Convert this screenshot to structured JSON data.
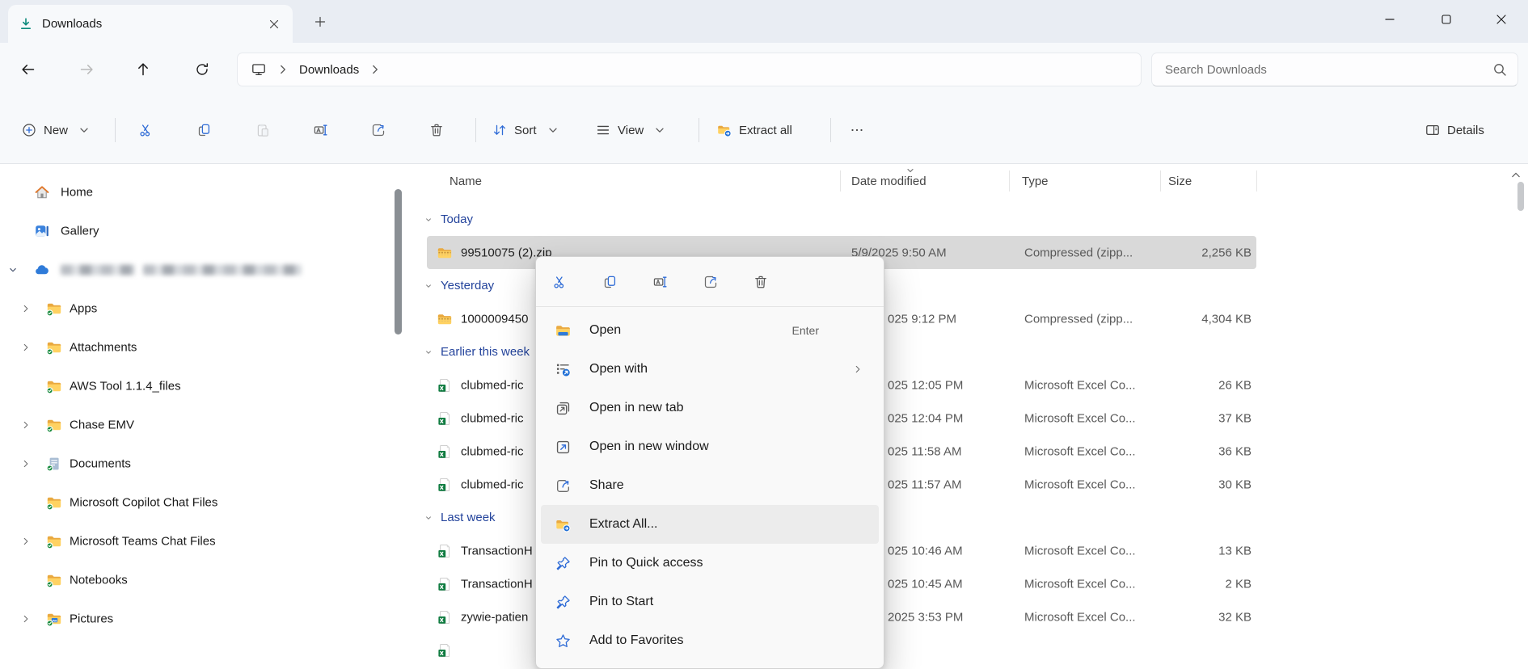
{
  "titlebar": {
    "tab_title": "Downloads"
  },
  "nav": {
    "breadcrumb": "Downloads"
  },
  "search": {
    "placeholder": "Search Downloads"
  },
  "toolbar": {
    "new": "New",
    "sort": "Sort",
    "view": "View",
    "extract_all": "Extract all",
    "details": "Details"
  },
  "colors": {
    "accent": "#2e6bd6",
    "group_header_text": "#24449c",
    "selected_row_bg": "#d9d9d9",
    "folder_yellow": "#ffd262",
    "excel_green": "#107c41",
    "onedrive_blue": "#2f7bd9"
  },
  "sidebar": {
    "items": [
      {
        "label": "Home",
        "icon": "home",
        "level": 0,
        "chevron": ""
      },
      {
        "label": "Gallery",
        "icon": "gallery",
        "level": 0,
        "chevron": ""
      },
      {
        "label": "",
        "icon": "cloud",
        "level": 0,
        "chevron": "down",
        "redacted": true
      },
      {
        "label": "Apps",
        "icon": "folder",
        "level": 1,
        "chevron": "right"
      },
      {
        "label": "Attachments",
        "icon": "folder",
        "level": 1,
        "chevron": "right"
      },
      {
        "label": "AWS Tool 1.1.4_files",
        "icon": "folder",
        "level": 1,
        "chevron": ""
      },
      {
        "label": "Chase EMV",
        "icon": "folder",
        "level": 1,
        "chevron": "right"
      },
      {
        "label": "Documents",
        "icon": "documents",
        "level": 1,
        "chevron": "right"
      },
      {
        "label": "Microsoft Copilot Chat Files",
        "icon": "folder",
        "level": 1,
        "chevron": ""
      },
      {
        "label": "Microsoft Teams Chat Files",
        "icon": "folder",
        "level": 1,
        "chevron": "right"
      },
      {
        "label": "Notebooks",
        "icon": "folder",
        "level": 1,
        "chevron": ""
      },
      {
        "label": "Pictures",
        "icon": "pictures",
        "level": 1,
        "chevron": "right"
      }
    ]
  },
  "list": {
    "columns": [
      "Name",
      "Date modified",
      "Type",
      "Size"
    ],
    "groups": [
      {
        "label": "Today",
        "rows": [
          {
            "name": "99510075 (2).zip",
            "icon": "zip",
            "date": "5/9/2025 9:50 AM",
            "clipped": false,
            "type": "Compressed (zipp...",
            "size": "2,256 KB",
            "selected": true
          }
        ]
      },
      {
        "label": "Yesterday",
        "rows": [
          {
            "name": "1000009450",
            "icon": "zip",
            "date": "025 9:12 PM",
            "clipped": true,
            "type": "Compressed (zipp...",
            "size": "4,304 KB",
            "selected": false
          }
        ]
      },
      {
        "label": "Earlier this week",
        "rows": [
          {
            "name": "clubmed-ric",
            "icon": "excel",
            "date": "025 12:05 PM",
            "clipped": true,
            "type": "Microsoft Excel Co...",
            "size": "26 KB",
            "selected": false
          },
          {
            "name": "clubmed-ric",
            "icon": "excel",
            "date": "025 12:04 PM",
            "clipped": true,
            "type": "Microsoft Excel Co...",
            "size": "37 KB",
            "selected": false
          },
          {
            "name": "clubmed-ric",
            "icon": "excel",
            "date": "025 11:58 AM",
            "clipped": true,
            "type": "Microsoft Excel Co...",
            "size": "36 KB",
            "selected": false
          },
          {
            "name": "clubmed-ric",
            "icon": "excel",
            "date": "025 11:57 AM",
            "clipped": true,
            "type": "Microsoft Excel Co...",
            "size": "30 KB",
            "selected": false
          }
        ]
      },
      {
        "label": "Last week",
        "rows": [
          {
            "name": "TransactionH",
            "icon": "excel",
            "date": "025 10:46 AM",
            "clipped": true,
            "type": "Microsoft Excel Co...",
            "size": "13 KB",
            "selected": false
          },
          {
            "name": "TransactionH",
            "icon": "excel",
            "date": "025 10:45 AM",
            "clipped": true,
            "type": "Microsoft Excel Co...",
            "size": "2 KB",
            "selected": false
          },
          {
            "name": "zywie-patien",
            "icon": "excel",
            "date": "2025 3:53 PM",
            "clipped": true,
            "type": "Microsoft Excel Co...",
            "size": "32 KB",
            "selected": false
          }
        ]
      }
    ],
    "partial_row": {
      "icon": "excel"
    }
  },
  "menu": {
    "quick_icons": [
      "cut",
      "copy",
      "rename",
      "share",
      "delete"
    ],
    "items": [
      {
        "label": "Open",
        "icon": "open",
        "shortcut": "Enter",
        "submenu": false,
        "highlighted": false
      },
      {
        "label": "Open with",
        "icon": "openwith",
        "shortcut": "",
        "submenu": true,
        "highlighted": false
      },
      {
        "label": "Open in new tab",
        "icon": "newtab",
        "shortcut": "",
        "submenu": false,
        "highlighted": false
      },
      {
        "label": "Open in new window",
        "icon": "newwindow",
        "shortcut": "",
        "submenu": false,
        "highlighted": false
      },
      {
        "label": "Share",
        "icon": "share",
        "shortcut": "",
        "submenu": false,
        "highlighted": false
      },
      {
        "label": "Extract All...",
        "icon": "extract",
        "shortcut": "",
        "submenu": false,
        "highlighted": true
      },
      {
        "label": "Pin to Quick access",
        "icon": "pin",
        "shortcut": "",
        "submenu": false,
        "highlighted": false
      },
      {
        "label": "Pin to Start",
        "icon": "pin",
        "shortcut": "",
        "submenu": false,
        "highlighted": false
      },
      {
        "label": "Add to Favorites",
        "icon": "star",
        "shortcut": "",
        "submenu": false,
        "highlighted": false
      }
    ]
  }
}
